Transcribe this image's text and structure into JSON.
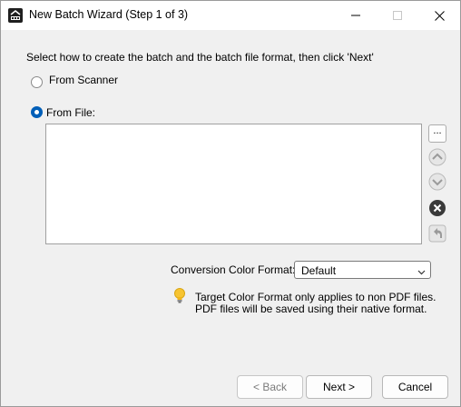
{
  "window": {
    "title": "New Batch Wizard (Step 1 of 3)"
  },
  "instruction": "Select how to create the batch and the batch file format, then click 'Next'",
  "source": {
    "option_scanner": "From Scanner",
    "option_file": "From File:",
    "selected": "From File:"
  },
  "file_list": {
    "items": [],
    "browse_label": "..."
  },
  "conversion": {
    "label": "Conversion Color Format:",
    "value": "Default"
  },
  "note": {
    "line1": "Target Color Format only applies to non PDF files.",
    "line2": "PDF files will be saved using their native format."
  },
  "buttons": {
    "back": "< Back",
    "next": "Next >",
    "cancel": "Cancel"
  },
  "icons": {
    "app": "app-logo-icon",
    "move_up": "chevron-up-icon",
    "move_down": "chevron-down-icon",
    "remove": "remove-circle-x-icon",
    "undo": "undo-arrow-icon",
    "tip": "lightbulb-icon"
  },
  "colors": {
    "accent": "#005fb8",
    "disabled_text": "#7a7a7a"
  }
}
